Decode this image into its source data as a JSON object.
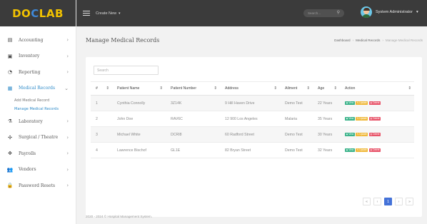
{
  "brand": {
    "logo_left": "DO",
    "logo_mid": "C",
    "logo_right": "LAB"
  },
  "topbar": {
    "create_new": "Create New",
    "search_placeholder": "Search...",
    "user_name": "System Administrator"
  },
  "sidebar": {
    "items": [
      {
        "label": "Accounting",
        "icon": "chart-icon"
      },
      {
        "label": "Inventory",
        "icon": "box-icon"
      },
      {
        "label": "Reporting",
        "icon": "clock-icon"
      },
      {
        "label": "Medical Records",
        "icon": "clipboard-icon"
      },
      {
        "label": "Laboratory",
        "icon": "flask-icon"
      },
      {
        "label": "Surgical / Theatre",
        "icon": "medical-icon"
      },
      {
        "label": "Payrolls",
        "icon": "payroll-icon"
      },
      {
        "label": "Vendors",
        "icon": "users-icon"
      },
      {
        "label": "Password Resets",
        "icon": "lock-icon"
      }
    ],
    "sub_items": [
      "Add Medical Record",
      "Manage Medical Records"
    ]
  },
  "page": {
    "title": "Manage Medical Records"
  },
  "breadcrumb": [
    "Dashboard",
    "Medical Records",
    "Manage Medical Records"
  ],
  "table": {
    "search_placeholder": "Search",
    "columns": [
      "#",
      "Patient Name",
      "Patient Number",
      "Address",
      "Ailment",
      "Age",
      "Action"
    ],
    "rows": [
      {
        "num": "1",
        "name": "Cynthia Connolly",
        "number": "3Z14K",
        "address": "9 Hill Haven Drive",
        "ailment": "Demo Test",
        "age": "22 Years"
      },
      {
        "num": "2",
        "name": "John Doe",
        "number": "RAV6C",
        "address": "12 900 Los Angeles",
        "ailment": "Malaria",
        "age": "35 Years"
      },
      {
        "num": "3",
        "name": "Michael White",
        "number": "DCRI8",
        "address": "60 Radford Street",
        "ailment": "Demo Test",
        "age": "30 Years"
      },
      {
        "num": "4",
        "name": "Lawrence Bischof",
        "number": "GL1E",
        "address": "82 Bryan Street",
        "ailment": "Demo Test",
        "age": "32 Years"
      }
    ],
    "actions": {
      "view": "View",
      "update": "Update",
      "delete": "Delete"
    }
  },
  "pagination": {
    "first": "«",
    "prev": "‹",
    "current": "1",
    "next": "›",
    "last": "»"
  },
  "footer": {
    "text": "2020 - 2024 © Hospital Management System."
  },
  "colors": {
    "accent": "#2e8bc9",
    "topbar": "#3b3b3b",
    "logo_yellow": "#f2c200",
    "logo_blue": "#3f88d8",
    "view": "#3bb38a",
    "update": "#f0b93b",
    "delete": "#e8556a",
    "page_active": "#4472d8"
  }
}
